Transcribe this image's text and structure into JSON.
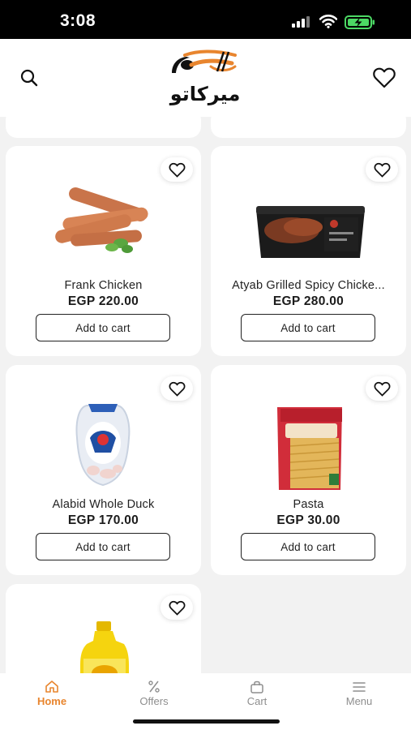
{
  "status_bar": {
    "time": "3:08",
    "icons": [
      "cellular-signal-icon",
      "wifi-icon",
      "battery-charging-icon"
    ]
  },
  "header": {
    "search_icon": "search-icon",
    "favorites_icon": "heart-icon",
    "logo_text": "ميركاتو",
    "brand_color": "#e8852e"
  },
  "products": [
    {
      "name": "",
      "price": "",
      "add_label": ""
    },
    {
      "name": "",
      "price": "",
      "add_label": ""
    },
    {
      "name": "Frank Chicken",
      "price": "EGP 220.00",
      "add_label": "Add to cart",
      "image_icon": "sausages-image"
    },
    {
      "name": "Atyab Grilled Spicy Chicke...",
      "price": "EGP 280.00",
      "add_label": "Add to cart",
      "image_icon": "grilled-chicken-tray-image"
    },
    {
      "name": "Alabid Whole Duck",
      "price": "EGP 170.00",
      "add_label": "Add to cart",
      "image_icon": "whole-duck-package-image"
    },
    {
      "name": "Pasta",
      "price": "EGP 30.00",
      "add_label": "Add to cart",
      "image_icon": "pasta-bag-image"
    },
    {
      "name": "",
      "price": "",
      "add_label": "",
      "image_icon": "oil-bottle-image"
    }
  ],
  "tabbar": {
    "items": [
      {
        "label": "Home",
        "icon": "home-icon",
        "active": true
      },
      {
        "label": "Offers",
        "icon": "percent-icon",
        "active": false
      },
      {
        "label": "Cart",
        "icon": "cart-bag-icon",
        "active": false
      },
      {
        "label": "Menu",
        "icon": "menu-icon",
        "active": false
      }
    ],
    "active_color": "#e8852e",
    "inactive_color": "#8e8e8e"
  }
}
